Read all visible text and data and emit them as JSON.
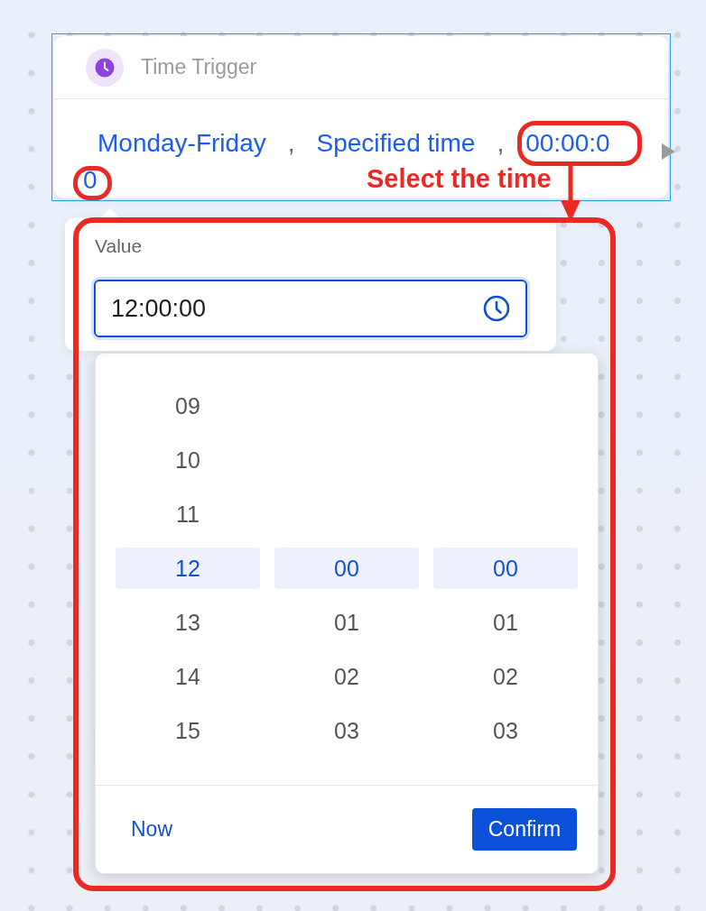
{
  "node": {
    "selected": true,
    "title": "Time Trigger",
    "conditions": [
      {
        "kind": "value",
        "text": "Monday-Friday"
      },
      {
        "kind": "separator",
        "text": ","
      },
      {
        "kind": "value",
        "text": "Specified time"
      },
      {
        "kind": "separator",
        "text": ","
      },
      {
        "kind": "value",
        "text": "00:00:00"
      }
    ]
  },
  "value_popover": {
    "label": "Value",
    "input": {
      "value": "12:00:00",
      "focused": true
    }
  },
  "time_picker": {
    "columns": [
      {
        "items": [
          {
            "text": "09",
            "selected": false
          },
          {
            "text": "10",
            "selected": false
          },
          {
            "text": "11",
            "selected": false
          },
          {
            "text": "12",
            "selected": true
          },
          {
            "text": "13",
            "selected": false
          },
          {
            "text": "14",
            "selected": false
          },
          {
            "text": "15",
            "selected": false
          }
        ]
      },
      {
        "items": [
          {
            "text": "00",
            "selected": true
          },
          {
            "text": "01",
            "selected": false
          },
          {
            "text": "02",
            "selected": false
          },
          {
            "text": "03",
            "selected": false
          }
        ]
      },
      {
        "items": [
          {
            "text": "00",
            "selected": true
          },
          {
            "text": "01",
            "selected": false
          },
          {
            "text": "02",
            "selected": false
          },
          {
            "text": "03",
            "selected": false
          }
        ]
      }
    ],
    "now_link": "Now",
    "confirm_button": "Confirm"
  },
  "annotation": {
    "label": "Select the time"
  }
}
